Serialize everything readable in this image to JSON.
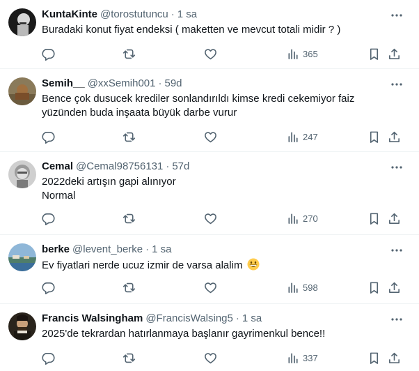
{
  "tweets": [
    {
      "name": "KuntaKinte",
      "handle": "@torostutuncu",
      "time": "1 sa",
      "lines": [
        "Buradaki konut fiyat endeksi ( maketten ve mevcut totali midir ? )"
      ],
      "views": "365"
    },
    {
      "name": "Semih__",
      "handle": "@xxSemih001",
      "time": "59d",
      "lines": [
        "Bence çok dusucek krediler sonlandırıldı kimse kredi cekemiyor faiz",
        "yüzünden buda inşaata büyük darbe vurur"
      ],
      "views": "247"
    },
    {
      "name": "Cemal",
      "handle": "@Cemal98756131",
      "time": "57d",
      "lines": [
        "2022deki artışın gapi alınıyor",
        "Normal"
      ],
      "views": "270"
    },
    {
      "name": "berke",
      "handle": "@levent_berke",
      "time": "1 sa",
      "lines": [
        "Ev fiyatlari nerde ucuz izmir de varsa alalim"
      ],
      "views": "598"
    },
    {
      "name": "Francis Walsingham",
      "handle": "@FrancisWalsing5",
      "time": "1 sa",
      "lines": [
        "2025'de tekrardan hatırlanmaya başlanır gayrimenkul bence!!"
      ],
      "views": "337"
    }
  ],
  "separator": "·",
  "icons": {
    "reply": "reply-icon",
    "retweet": "retweet-icon",
    "like": "heart-icon",
    "views": "views-icon",
    "bookmark": "bookmark-icon",
    "share": "share-icon",
    "more": "more-icon"
  },
  "colors": {
    "text": "#0f1419",
    "secondary": "#536471",
    "border": "#eff3f4"
  }
}
